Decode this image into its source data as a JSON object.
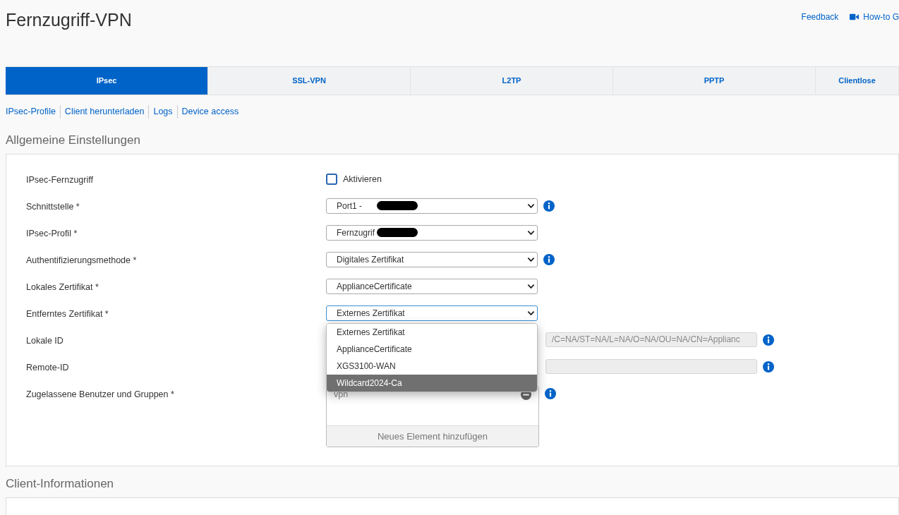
{
  "title": "Fernzugriff-VPN",
  "header_links": [
    {
      "label": "Feedback",
      "kind": "text"
    },
    {
      "label": "How-to G",
      "kind": "video"
    }
  ],
  "tabs": [
    {
      "label": "IPsec",
      "selected": true
    },
    {
      "label": "SSL-VPN",
      "selected": false
    },
    {
      "label": "L2TP",
      "selected": false
    },
    {
      "label": "PPTP",
      "selected": false
    },
    {
      "label": "Clientlose",
      "selected": false
    }
  ],
  "subnav": [
    "IPsec-Profile",
    "Client herunterladen",
    "Logs",
    "Device access"
  ],
  "general": {
    "heading": "Allgemeine Einstellungen",
    "fields": [
      {
        "label": "IPsec-Fernzugriff",
        "kind": "checkbox",
        "option": "Aktivieren",
        "checked": false
      },
      {
        "label": "Schnittstelle *",
        "kind": "select",
        "value": "Port1 -",
        "redacted": true,
        "info": true
      },
      {
        "label": "IPsec-Profil *",
        "kind": "select",
        "value": "Fernzugrif",
        "redacted": true,
        "info": false
      },
      {
        "label": "Authentifizierungsmethode *",
        "kind": "select",
        "value": "Digitales Zertifikat",
        "info": true
      },
      {
        "label": "Lokales Zertifikat *",
        "kind": "select",
        "value": "ApplianceCertificate",
        "info": false
      },
      {
        "label": "Entferntes Zertifikat *",
        "kind": "select",
        "value": "Externes Zertifikat",
        "focused": true,
        "info": false,
        "options": [
          {
            "label": "Externes Zertifikat",
            "highlighted": false
          },
          {
            "label": "ApplianceCertificate",
            "highlighted": false
          },
          {
            "label": "XGS3100-WAN",
            "highlighted": false
          },
          {
            "label": "Wildcard2024-Ca",
            "highlighted": true
          }
        ]
      },
      {
        "label": "Lokale ID",
        "kind": "text",
        "value": "/C=NA/ST=NA/L=NA/O=NA/OU=NA/CN=Applianc",
        "info": true
      },
      {
        "label": "Remote-ID",
        "kind": "text",
        "info": true
      },
      {
        "label": "Zugelassene Benutzer und Gruppen *",
        "kind": "list",
        "items": [
          "vpn"
        ],
        "add_label": "Neues Element hinzufügen",
        "info": true
      }
    ]
  },
  "client_info": {
    "heading": "Client-Informationen"
  }
}
